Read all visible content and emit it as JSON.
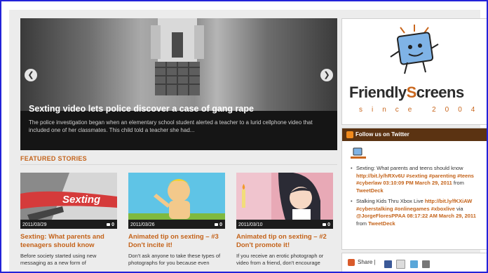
{
  "slider": {
    "title": "Sexting video lets police discover a case of gang rape",
    "description": "The police investigation began when an elementary school student alerted a teacher to a lurid cellphone video that included one of her classmates. This child told a teacher she had...",
    "prev_icon": "chevron-left-icon",
    "next_icon": "chevron-right-icon"
  },
  "featured": {
    "heading": "FEATURED STORIES",
    "stories": [
      {
        "date": "2011/03/29",
        "comments": "0",
        "thumb_word": "Sexting",
        "title": "Sexting: What parents and teenagers should know",
        "excerpt": "Before society started using new messaging as a new form of"
      },
      {
        "date": "2011/03/26",
        "comments": "0",
        "title": "Animated tip on sexting – #3 Don't incite it!",
        "excerpt": "Don't ask anyone to take these types of photographs for you because even"
      },
      {
        "date": "2011/03/10",
        "comments": "0",
        "title": "Animated tip on sexting – #2 Don't promote it!",
        "excerpt": "If you receive an erotic photograph or video from a friend, don't encourage"
      }
    ]
  },
  "logo": {
    "name_part1": "Friendly",
    "name_highlight": "S",
    "name_part2": "creens",
    "since": "since 2004"
  },
  "twitter": {
    "heading": "Follow us on Twitter",
    "tweets": [
      {
        "text": "Sexting: What parents and teens should know",
        "link": "http://bit.ly/hRXv6U #sexting #parenting #teens #cyberlaw 03:10:09 PM March 29, 2011",
        "from_prefix": "from",
        "from": "TweetDeck"
      },
      {
        "text": "Stalking Kids Thru Xbox Live",
        "link": "http://bit.ly/fKXiAW #cyberstalking #onlinegames #xboxlive",
        "via_prefix": "via",
        "via": "@JorgeFloresPPAA 08:17:22 AM March 29, 2011",
        "from_prefix": "from",
        "from": "TweetDeck"
      }
    ]
  },
  "share": {
    "label": "Share",
    "separator": "|",
    "icons": [
      "facebook-icon",
      "email-icon",
      "twitter-icon",
      "print-icon"
    ]
  },
  "colors": {
    "accent": "#c4631a",
    "frame_border": "#2323d8",
    "twitter_header": "#5b3312"
  }
}
